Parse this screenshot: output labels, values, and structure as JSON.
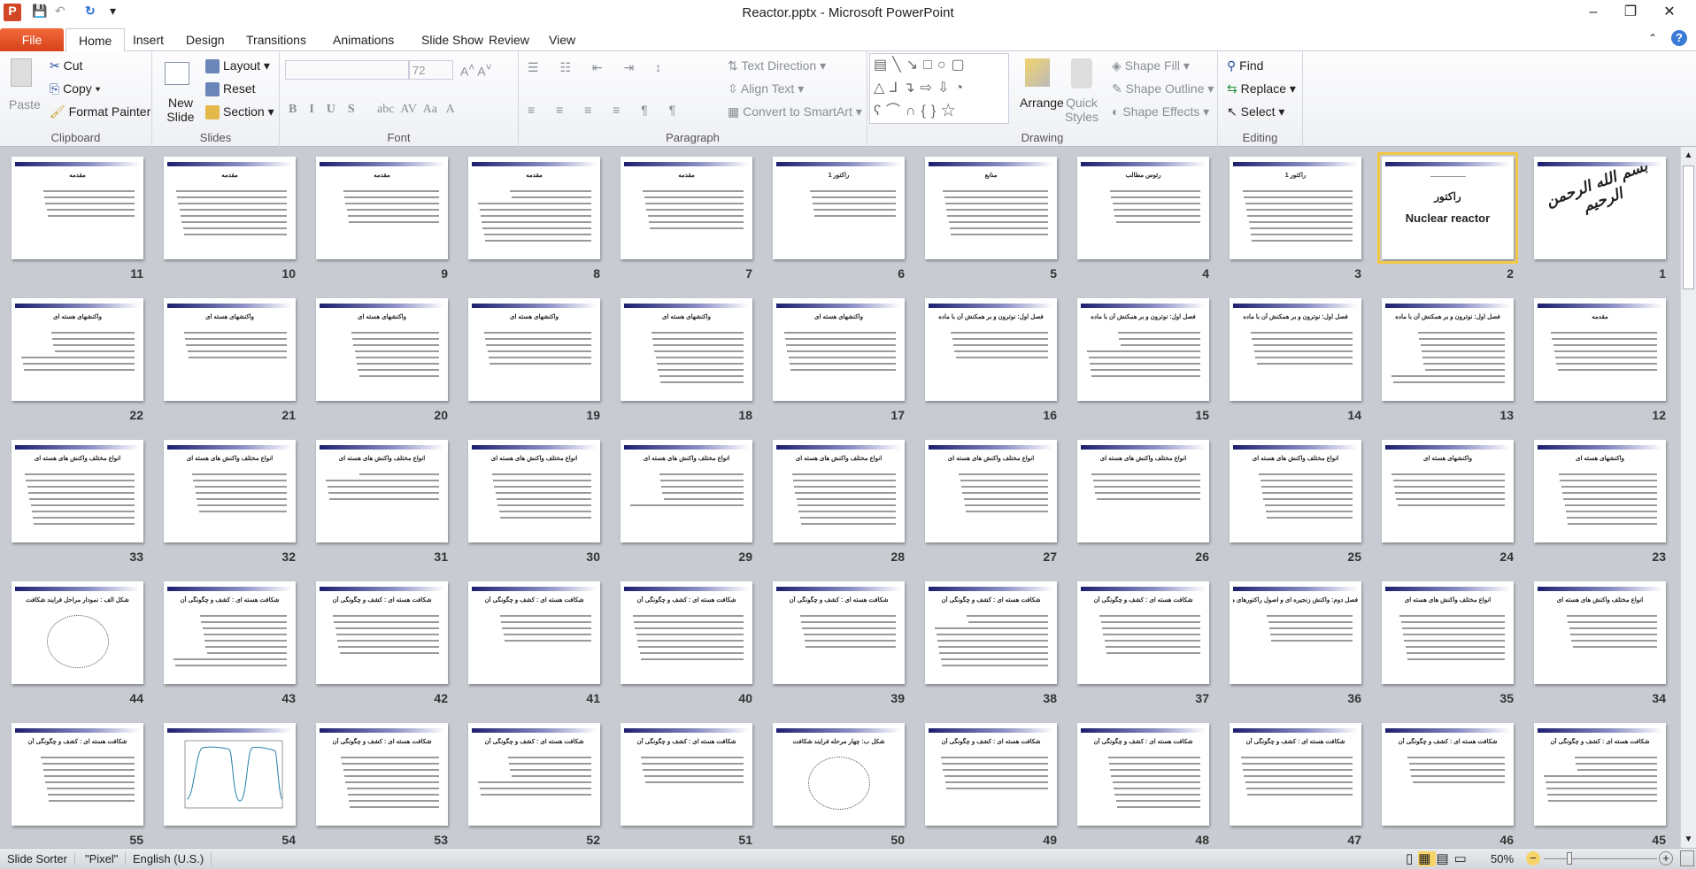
{
  "window": {
    "title": "Reactor.pptx - Microsoft PowerPoint",
    "minimize": "–",
    "restore": "❐",
    "close": "✕"
  },
  "quick_access": {
    "save": "save-icon",
    "undo": "undo-icon",
    "redo": "redo-icon",
    "customize": "▾"
  },
  "tabs": [
    "File",
    "Home",
    "Insert",
    "Design",
    "Transitions",
    "Animations",
    "Slide Show",
    "Review",
    "View"
  ],
  "active_tab": "Home",
  "ribbon": {
    "clipboard": {
      "label": "Clipboard",
      "paste": "Paste",
      "cut": "Cut",
      "copy": "Copy",
      "format_painter": "Format Painter"
    },
    "slides": {
      "label": "Slides",
      "new_slide": "New Slide",
      "layout": "Layout",
      "reset": "Reset",
      "section": "Section"
    },
    "font": {
      "label": "Font",
      "font_name": "",
      "font_size": "72"
    },
    "paragraph": {
      "label": "Paragraph",
      "text_direction": "Text Direction",
      "align_text": "Align Text",
      "convert_smartart": "Convert to SmartArt"
    },
    "drawing": {
      "label": "Drawing",
      "arrange": "Arrange",
      "quick_styles": "Quick Styles",
      "shape_fill": "Shape Fill",
      "shape_outline": "Shape Outline",
      "shape_effects": "Shape Effects"
    },
    "editing": {
      "label": "Editing",
      "find": "Find",
      "replace": "Replace",
      "select": "Select"
    }
  },
  "slides": [
    {
      "n": "1",
      "title": "",
      "kind": "calligraphy",
      "art": "بسم الله الرحمن الرحیم"
    },
    {
      "n": "2",
      "title": "راکتور",
      "subtitle": "Nuclear reactor",
      "kind": "titleslide",
      "selected": true
    },
    {
      "n": "3",
      "title": "راکتور 1"
    },
    {
      "n": "4",
      "title": "رئوس مطالب"
    },
    {
      "n": "5",
      "title": "منابع"
    },
    {
      "n": "6",
      "title": "راکتور 1"
    },
    {
      "n": "7",
      "title": "مقدمه"
    },
    {
      "n": "8",
      "title": "مقدمه"
    },
    {
      "n": "9",
      "title": "مقدمه"
    },
    {
      "n": "10",
      "title": "مقدمه"
    },
    {
      "n": "11",
      "title": "مقدمه"
    },
    {
      "n": "12",
      "title": "مقدمه"
    },
    {
      "n": "13",
      "title": "فصل اول: نوترون و بر همکنش آن با ماده"
    },
    {
      "n": "14",
      "title": "فصل اول: نوترون و بر همکنش آن با ماده"
    },
    {
      "n": "15",
      "title": "فصل اول: نوترون و بر همکنش آن با ماده"
    },
    {
      "n": "16",
      "title": "فصل اول: نوترون و بر همکنش آن با ماده"
    },
    {
      "n": "17",
      "title": "واکنشهای هسته ای"
    },
    {
      "n": "18",
      "title": "واکنشهای هسته ای"
    },
    {
      "n": "19",
      "title": "واکنشهای هسته ای"
    },
    {
      "n": "20",
      "title": "واکنشهای هسته ای"
    },
    {
      "n": "21",
      "title": "واکنشهای هسته ای"
    },
    {
      "n": "22",
      "title": "واکنشهای هسته ای"
    },
    {
      "n": "23",
      "title": "واکنشهای هسته ای"
    },
    {
      "n": "24",
      "title": "واکنشهای هسته ای"
    },
    {
      "n": "25",
      "title": "انواع مختلف واکنش های هسته ای"
    },
    {
      "n": "26",
      "title": "انواع مختلف واکنش های هسته ای"
    },
    {
      "n": "27",
      "title": "انواع مختلف واکنش های هسته ای"
    },
    {
      "n": "28",
      "title": "انواع مختلف واکنش های هسته ای"
    },
    {
      "n": "29",
      "title": "انواع مختلف واکنش های هسته ای"
    },
    {
      "n": "30",
      "title": "انواع مختلف واکنش های هسته ای"
    },
    {
      "n": "31",
      "title": "انواع مختلف واکنش های هسته ای"
    },
    {
      "n": "32",
      "title": "انواع مختلف واکنش های هسته ای"
    },
    {
      "n": "33",
      "title": "انواع مختلف واکنش های هسته ای"
    },
    {
      "n": "34",
      "title": "انواع مختلف واکنش های هسته ای"
    },
    {
      "n": "35",
      "title": "انواع مختلف واکنش های هسته ای"
    },
    {
      "n": "36",
      "title": "فصل دوم: واکنش زنجیره ای و اصول راکتورهای هسته ای"
    },
    {
      "n": "37",
      "title": "شکافت هسته ای : کشف و چگونگی آن"
    },
    {
      "n": "38",
      "title": "شکافت هسته ای : کشف و چگونگی آن"
    },
    {
      "n": "39",
      "title": "شکافت هسته ای : کشف و چگونگی آن"
    },
    {
      "n": "40",
      "title": "شکافت هسته ای : کشف و چگونگی آن"
    },
    {
      "n": "41",
      "title": "شکافت هسته ای : کشف و چگونگی آن"
    },
    {
      "n": "42",
      "title": "شکافت هسته ای : کشف و چگونگی آن"
    },
    {
      "n": "43",
      "title": "شکافت هسته ای : کشف و چگونگی آن"
    },
    {
      "n": "44",
      "title": "شکل الف : نمودار مراحل فرایند شکافت",
      "kind": "figure"
    },
    {
      "n": "45",
      "title": "شکافت هسته ای : کشف و چگونگی آن"
    },
    {
      "n": "46",
      "title": "شکافت هسته ای : کشف و چگونگی آن"
    },
    {
      "n": "47",
      "title": "شکافت هسته ای : کشف و چگونگی آن"
    },
    {
      "n": "48",
      "title": "شکافت هسته ای : کشف و چگونگی آن"
    },
    {
      "n": "49",
      "title": "شکافت هسته ای : کشف و چگونگی آن"
    },
    {
      "n": "50",
      "title": "شکل ب: چهار مرحله فرایند شکافت",
      "kind": "figure"
    },
    {
      "n": "51",
      "title": "شکافت هسته ای : کشف و چگونگی آن"
    },
    {
      "n": "52",
      "title": "شکافت هسته ای : کشف و چگونگی آن"
    },
    {
      "n": "53",
      "title": "شکافت هسته ای : کشف و چگونگی آن"
    },
    {
      "n": "54",
      "title": "",
      "kind": "chart"
    },
    {
      "n": "55",
      "title": "شکافت هسته ای : کشف و چگونگی آن"
    }
  ],
  "status": {
    "view": "Slide Sorter",
    "theme": "\"Pixel\"",
    "language": "English (U.S.)",
    "zoom": "50%",
    "zoom_level_percent": 50
  },
  "colors": {
    "file_tab": "#d8421b",
    "selection": "#f2c744",
    "sorter_bg": "#c8ccd2",
    "slide_bar": "#1c1f6e"
  }
}
